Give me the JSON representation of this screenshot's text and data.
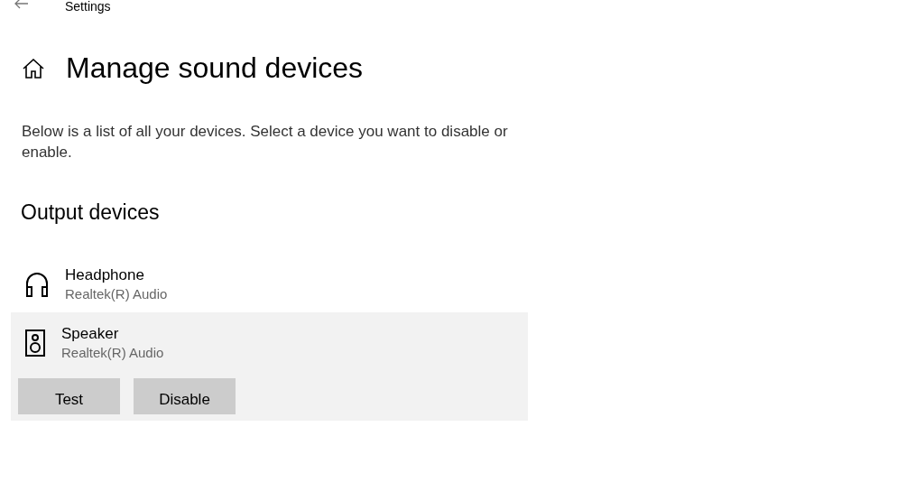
{
  "window": {
    "title": "Settings"
  },
  "page": {
    "title": "Manage sound devices",
    "description": "Below is a list of all your devices. Select a device you want to disable or enable."
  },
  "section": {
    "title": "Output devices"
  },
  "devices": [
    {
      "kind": "headphone",
      "name": "Headphone",
      "driver": "Realtek(R) Audio",
      "selected": false
    },
    {
      "kind": "speaker",
      "name": "Speaker",
      "driver": "Realtek(R) Audio",
      "selected": true,
      "buttons": [
        "Test",
        "Disable"
      ]
    }
  ]
}
